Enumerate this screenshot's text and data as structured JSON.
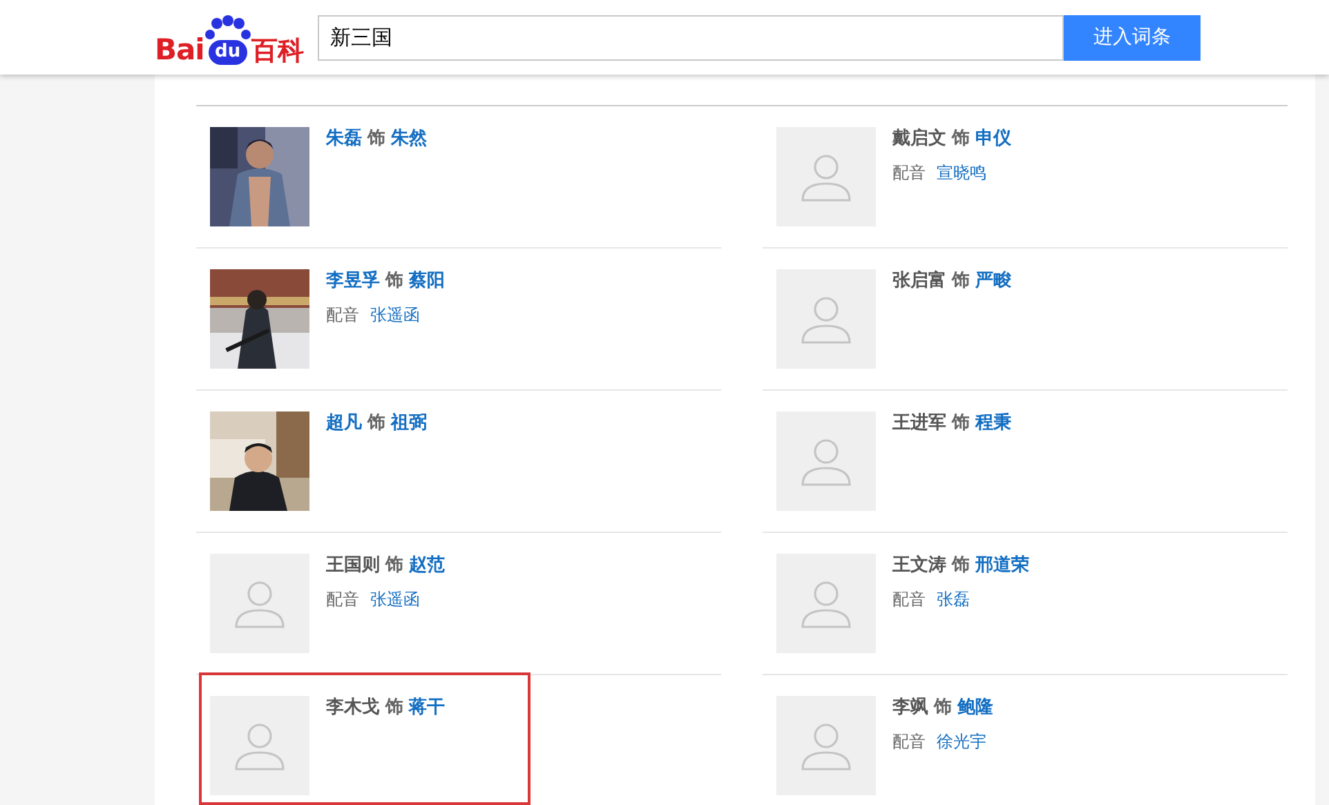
{
  "header": {
    "logo": {
      "left": "Bai",
      "paw": "du",
      "right": "百科"
    },
    "search": {
      "value": "新三国"
    },
    "button": "进入词条"
  },
  "cast": [
    {
      "actor": "朱磊",
      "actor_linked": true,
      "role_word": "饰",
      "character": "朱然",
      "kind": "picture",
      "highlighted": false
    },
    {
      "actor": "戴启文",
      "actor_linked": false,
      "role_word": "饰",
      "character": "申仪",
      "voice_label": "配音",
      "voice": "宣晓鸣",
      "kind": "placeholder",
      "highlighted": false
    },
    {
      "actor": "李昱孚",
      "actor_linked": true,
      "role_word": "饰",
      "character": "蔡阳",
      "voice_label": "配音",
      "voice": "张遥函",
      "kind": "picture",
      "highlighted": false
    },
    {
      "actor": "张启富",
      "actor_linked": false,
      "role_word": "饰",
      "character": "严畯",
      "kind": "placeholder",
      "highlighted": false
    },
    {
      "actor": "超凡",
      "actor_linked": true,
      "role_word": "饰",
      "character": "祖弼",
      "kind": "picture",
      "highlighted": false
    },
    {
      "actor": "王进军",
      "actor_linked": false,
      "role_word": "饰",
      "character": "程秉",
      "kind": "placeholder",
      "highlighted": false
    },
    {
      "actor": "王国则",
      "actor_linked": false,
      "role_word": "饰",
      "character": "赵范",
      "voice_label": "配音",
      "voice": "张遥函",
      "kind": "placeholder",
      "highlighted": false
    },
    {
      "actor": "王文涛",
      "actor_linked": false,
      "role_word": "饰",
      "character": "邢道荣",
      "voice_label": "配音",
      "voice": "张磊",
      "kind": "placeholder",
      "highlighted": false
    },
    {
      "actor": "李木戈",
      "actor_linked": false,
      "role_word": "饰",
      "character": "蒋干",
      "kind": "placeholder",
      "highlighted": true
    },
    {
      "actor": "李飒",
      "actor_linked": false,
      "role_word": "饰",
      "character": "鲍隆",
      "voice_label": "配音",
      "voice": "徐光宇",
      "kind": "placeholder",
      "highlighted": false
    }
  ]
}
